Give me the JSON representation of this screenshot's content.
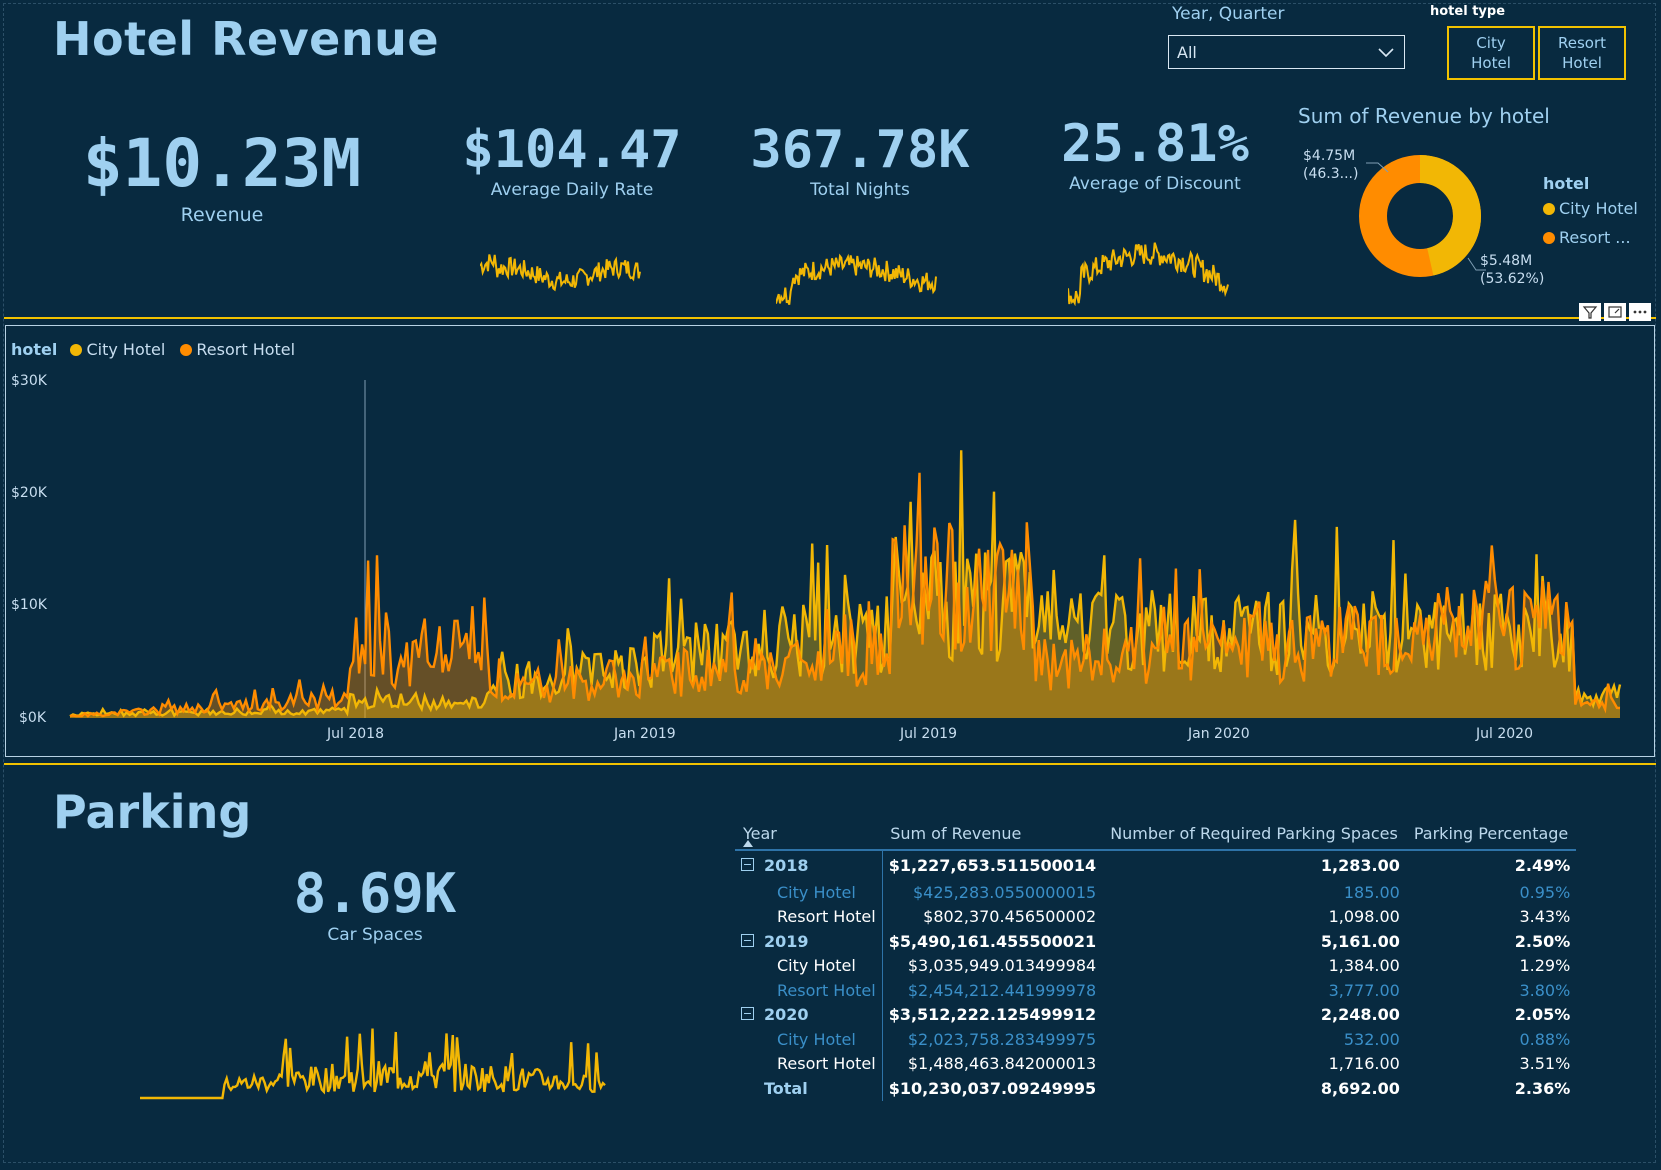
{
  "header": {
    "title": "Hotel Revenue"
  },
  "kpis": {
    "revenue": {
      "value": "$10.23M",
      "label": "Revenue"
    },
    "adr": {
      "value": "$104.47",
      "label": "Average Daily Rate"
    },
    "nights": {
      "value": "367.78K",
      "label": "Total Nights"
    },
    "discount": {
      "value": "25.81%",
      "label": "Average of Discount"
    }
  },
  "slicers": {
    "year_quarter": {
      "label": "Year, Quarter",
      "selected": "All",
      "icon": "chevron-down-icon"
    },
    "hotel_type": {
      "label": "hotel type",
      "buttons": [
        "City\nHotel",
        "Resort\nHotel"
      ]
    }
  },
  "colors": {
    "city": "#f2b705",
    "resort": "#ff8c00",
    "background": "#082a40",
    "accent": "#f2c200"
  },
  "donut": {
    "title": "Sum of Revenue by hotel",
    "legend_title": "hotel",
    "legend": [
      "City Hotel",
      "Resort ..."
    ],
    "label_city_value": "$4.75M",
    "label_city_pct": "(46.3...)",
    "label_resort_value": "$5.48M",
    "label_resort_pct": "(53.62%)"
  },
  "area_chart": {
    "legend_title": "hotel",
    "legend": [
      "City Hotel",
      "Resort Hotel"
    ],
    "y_ticks": [
      "$30K",
      "$20K",
      "$10K",
      "$0K"
    ],
    "x_ticks": [
      "Jul 2018",
      "Jan 2019",
      "Jul 2019",
      "Jan 2020",
      "Jul 2020"
    ]
  },
  "visual_header_icons": [
    "filter-icon",
    "focus-mode-icon",
    "more-options-icon"
  ],
  "parking": {
    "title": "Parking",
    "kpi_value": "8.69K",
    "kpi_label": "Car Spaces",
    "table": {
      "headers": [
        "Year",
        "Sum of Revenue",
        "Number of Required Parking Spaces",
        "Parking Percentage"
      ],
      "rows": [
        {
          "label": "2018",
          "revenue": "$1,227,653.511500014",
          "spaces": "1,283.00",
          "pct": "2.49%"
        },
        {
          "label": "City Hotel",
          "revenue": "$425,283.0550000015",
          "spaces": "185.00",
          "pct": "0.95%"
        },
        {
          "label": "Resort Hotel",
          "revenue": "$802,370.456500002",
          "spaces": "1,098.00",
          "pct": "3.43%"
        },
        {
          "label": "2019",
          "revenue": "$5,490,161.455500021",
          "spaces": "5,161.00",
          "pct": "2.50%"
        },
        {
          "label": "City Hotel",
          "revenue": "$3,035,949.013499984",
          "spaces": "1,384.00",
          "pct": "1.29%"
        },
        {
          "label": "Resort Hotel",
          "revenue": "$2,454,212.441999978",
          "spaces": "3,777.00",
          "pct": "3.80%"
        },
        {
          "label": "2020",
          "revenue": "$3,512,222.125499912",
          "spaces": "2,248.00",
          "pct": "2.05%"
        },
        {
          "label": "City Hotel",
          "revenue": "$2,023,758.283499975",
          "spaces": "532.00",
          "pct": "0.88%"
        },
        {
          "label": "Resort Hotel",
          "revenue": "$1,488,463.842000013",
          "spaces": "1,716.00",
          "pct": "3.51%"
        },
        {
          "label": "Total",
          "revenue": "$10,230,037.09249995",
          "spaces": "8,692.00",
          "pct": "2.36%"
        }
      ]
    }
  }
}
